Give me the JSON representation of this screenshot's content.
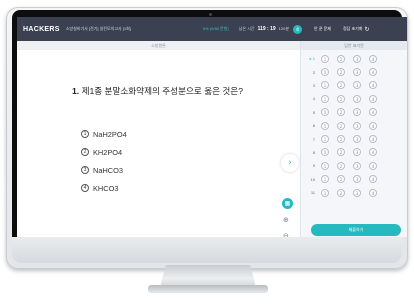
{
  "header": {
    "logo": "HACKERS",
    "exam_title": "소방설비기사 [전기] 실전모의고사 [1회]",
    "progress": "0% (0/80 문항)",
    "timer_label": "남은 시간",
    "time_left": "119 : 19",
    "time_total": "120분",
    "timer_badge": "⏱",
    "menu_label": "안 푼 문제",
    "end_label": "정답 초기화",
    "accent_color": "#27b9c0"
  },
  "question_pane": {
    "header": "소방원론",
    "question_number": "1.",
    "question_text": "제1종 분말소화약제의 주성분으로 옳은 것은?",
    "options": [
      {
        "marker": "1",
        "text": "NaH2PO4"
      },
      {
        "marker": "2",
        "text": "KH2PO4"
      },
      {
        "marker": "3",
        "text": "NaHCO3"
      },
      {
        "marker": "4",
        "text": "KHCO3"
      }
    ],
    "next_icon": "chevron-right-icon"
  },
  "answer_pane": {
    "header": "답안 표기란",
    "rows": [
      {
        "no": "▸ 1"
      },
      {
        "no": "2"
      },
      {
        "no": "3"
      },
      {
        "no": "4"
      },
      {
        "no": "5"
      },
      {
        "no": "6"
      },
      {
        "no": "7"
      },
      {
        "no": "8"
      },
      {
        "no": "9"
      },
      {
        "no": "10"
      },
      {
        "no": "11"
      }
    ],
    "choices": [
      "1",
      "2",
      "3",
      "4"
    ],
    "submit_label": "제출하기"
  }
}
